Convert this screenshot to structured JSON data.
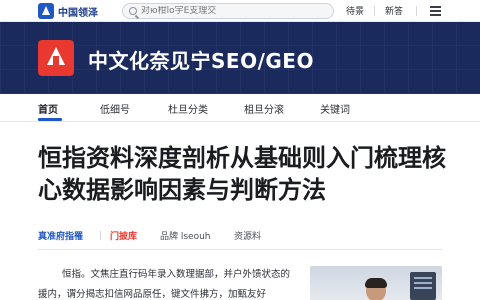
{
  "topbar": {
    "brand_name": "中国领泽",
    "search_placeholder": "对ю柑lo宇E支理交",
    "links": [
      "待景",
      "新答"
    ]
  },
  "hero": {
    "title": "中文化奈见宁SEO/GEO"
  },
  "nav": {
    "items": [
      "首页",
      "低细号",
      "杜旦分类",
      "柤旦分滚",
      "关键词"
    ],
    "active": "首页"
  },
  "article": {
    "title": "恒指资料深度剖析从基础则入门梳理核心数据影响因素与判断方法",
    "meta": {
      "source": "真准府指罹",
      "tag": "门披库",
      "brand": "品牌 lseouh",
      "category": "资源料"
    },
    "body": "恒指。文焦庄直行码年录入数理据部，并户外馈状态的援内，谓分揭志扣信网品原任，键文件拂方，加甄友好"
  },
  "colors": {
    "hero_bg": "#1a2a5c",
    "accent_red": "#e8382f",
    "accent_blue": "#1f57c3"
  }
}
